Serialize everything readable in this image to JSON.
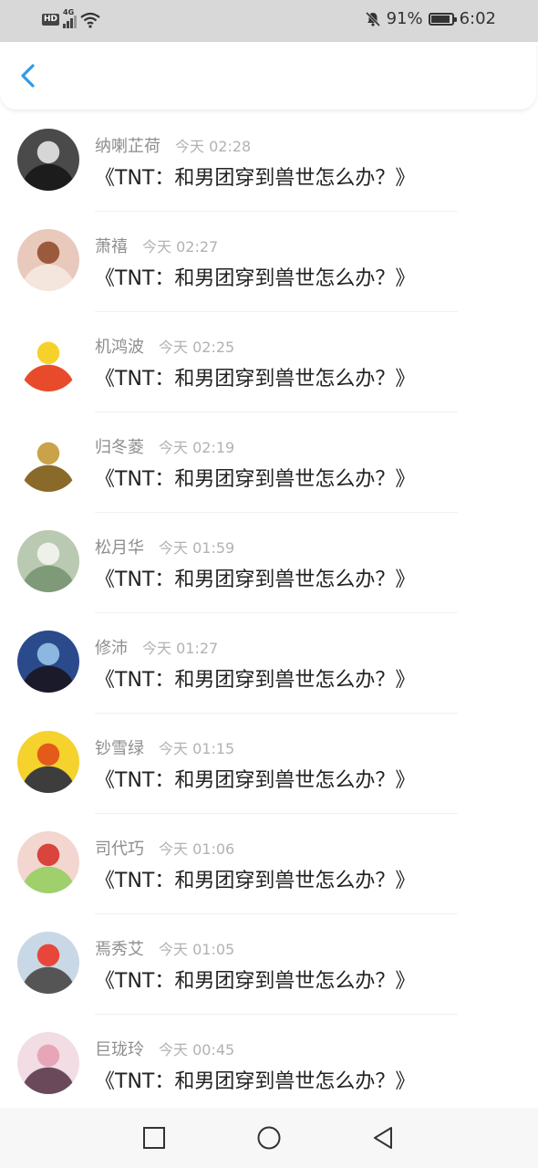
{
  "status_bar": {
    "hd": "HD",
    "network": "4G",
    "battery": "91%",
    "battery_level": 0.91,
    "time": "6:02"
  },
  "header": {
    "back_icon": "chevron-left-icon",
    "accent": "#2f9be8"
  },
  "items": [
    {
      "name": "纳喇芷荷",
      "time": "今天 02:28",
      "title": "《TNT：和男团穿到兽世怎么办？》",
      "avatar_colors": [
        "#4a4a4a",
        "#d6d6d6",
        "#1c1c1c"
      ]
    },
    {
      "name": "萧禧",
      "time": "今天 02:27",
      "title": "《TNT：和男团穿到兽世怎么办？》",
      "avatar_colors": [
        "#e8c9bc",
        "#9c5a3c",
        "#f4e6dd"
      ]
    },
    {
      "name": "机鸿波",
      "time": "今天 02:25",
      "title": "《TNT：和男团穿到兽世怎么办？》",
      "avatar_colors": [
        "#ffffff",
        "#f6d12a",
        "#e84b2c"
      ]
    },
    {
      "name": "归冬菱",
      "time": "今天 02:19",
      "title": "《TNT：和男团穿到兽世怎么办？》",
      "avatar_colors": [
        "#ffffff",
        "#c9a24a",
        "#8a6a2a"
      ]
    },
    {
      "name": "松月华",
      "time": "今天 01:59",
      "title": "《TNT：和男团穿到兽世怎么办？》",
      "avatar_colors": [
        "#b9c9b2",
        "#eef1ea",
        "#7f9a78"
      ]
    },
    {
      "name": "修沛",
      "time": "今天 01:27",
      "title": "《TNT：和男团穿到兽世怎么办？》",
      "avatar_colors": [
        "#2a4a8c",
        "#8bb7e0",
        "#1a1a2a"
      ]
    },
    {
      "name": "钞雪绿",
      "time": "今天 01:15",
      "title": "《TNT：和男团穿到兽世怎么办？》",
      "avatar_colors": [
        "#f5d22c",
        "#e35a1b",
        "#3d3d3d"
      ]
    },
    {
      "name": "司代巧",
      "time": "今天 01:06",
      "title": "《TNT：和男团穿到兽世怎么办？》",
      "avatar_colors": [
        "#f3d6cf",
        "#d9443c",
        "#9fd06b"
      ]
    },
    {
      "name": "焉秀艾",
      "time": "今天 01:05",
      "title": "《TNT：和男团穿到兽世怎么办？》",
      "avatar_colors": [
        "#c9d8e6",
        "#e8463a",
        "#555555"
      ]
    },
    {
      "name": "巨珑玲",
      "time": "今天 00:45",
      "title": "《TNT：和男团穿到兽世怎么办？》",
      "avatar_colors": [
        "#f1dde3",
        "#e7a6b8",
        "#6a4a5a"
      ]
    }
  ],
  "nav": {
    "recent_icon": "square-icon",
    "home_icon": "circle-icon",
    "back_icon": "triangle-back-icon"
  }
}
